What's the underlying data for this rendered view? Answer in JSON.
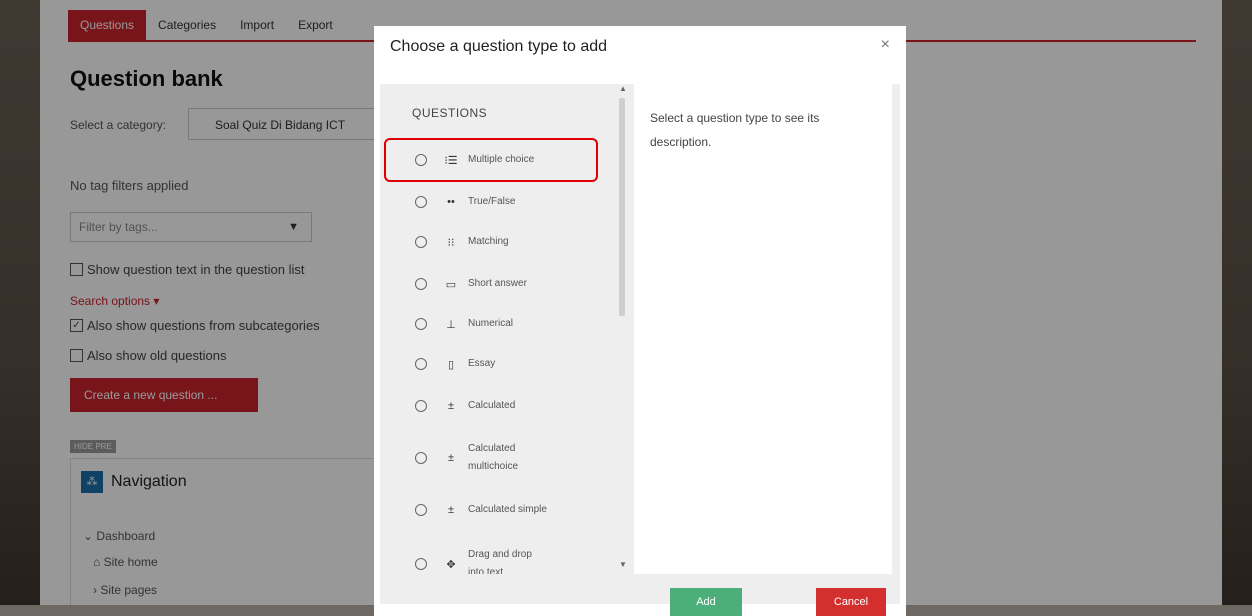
{
  "bg_tabs": [
    {
      "label": "Questions"
    },
    {
      "label": "Categories"
    },
    {
      "label": "Import"
    },
    {
      "label": "Export"
    }
  ],
  "bg": {
    "title": "Question bank",
    "category_label": "Select a category:",
    "category_value": "Soal Quiz Di Bidang ICT",
    "no_tag_filters": "No tag filters applied",
    "filter_placeholder": "Filter by tags...",
    "show_question_text": "Show question text in the question list",
    "search_options": "Search options",
    "also_subcategories": "Also show questions from subcategories",
    "also_old": "Also show old questions",
    "create_button": "Create a new question ...",
    "hide_badge": "HIDE PRE",
    "navigation_title": "Navigation",
    "nav_dashboard": "Dashboard",
    "nav_site_home": "Site home",
    "nav_site_pages": "Site pages"
  },
  "modal": {
    "title": "Choose a question type to add",
    "close_glyph": "×",
    "section_header": "QUESTIONS",
    "description": "Select a question type to see its description.",
    "add_button": "Add",
    "cancel_button": "Cancel"
  },
  "question_types": [
    {
      "label": "Multiple choice",
      "icon": "multiple-choice-icon",
      "glyph": "⁝☰"
    },
    {
      "label": "True/False",
      "icon": "true-false-icon",
      "glyph": "••"
    },
    {
      "label": "Matching",
      "icon": "matching-icon",
      "glyph": "⁝⁝"
    },
    {
      "label": "Short answer",
      "icon": "short-answer-icon",
      "glyph": "▭"
    },
    {
      "label": "Numerical",
      "icon": "numerical-icon",
      "glyph": "⊥"
    },
    {
      "label": "Essay",
      "icon": "essay-icon",
      "glyph": "▯"
    },
    {
      "label": "Calculated",
      "icon": "calculated-icon",
      "glyph": "±"
    },
    {
      "label": "Calculated multichoice",
      "icon": "calculated-multichoice-icon",
      "glyph": "±"
    },
    {
      "label": "Calculated simple",
      "icon": "calculated-simple-icon",
      "glyph": "±"
    },
    {
      "label": "Drag and drop into text",
      "icon": "drag-drop-icon",
      "glyph": "✥"
    }
  ],
  "colors": {
    "brand_red": "#c8232c",
    "add_green": "#4caf7a",
    "cancel_red": "#d32f2f",
    "highlight": "#e00000"
  }
}
